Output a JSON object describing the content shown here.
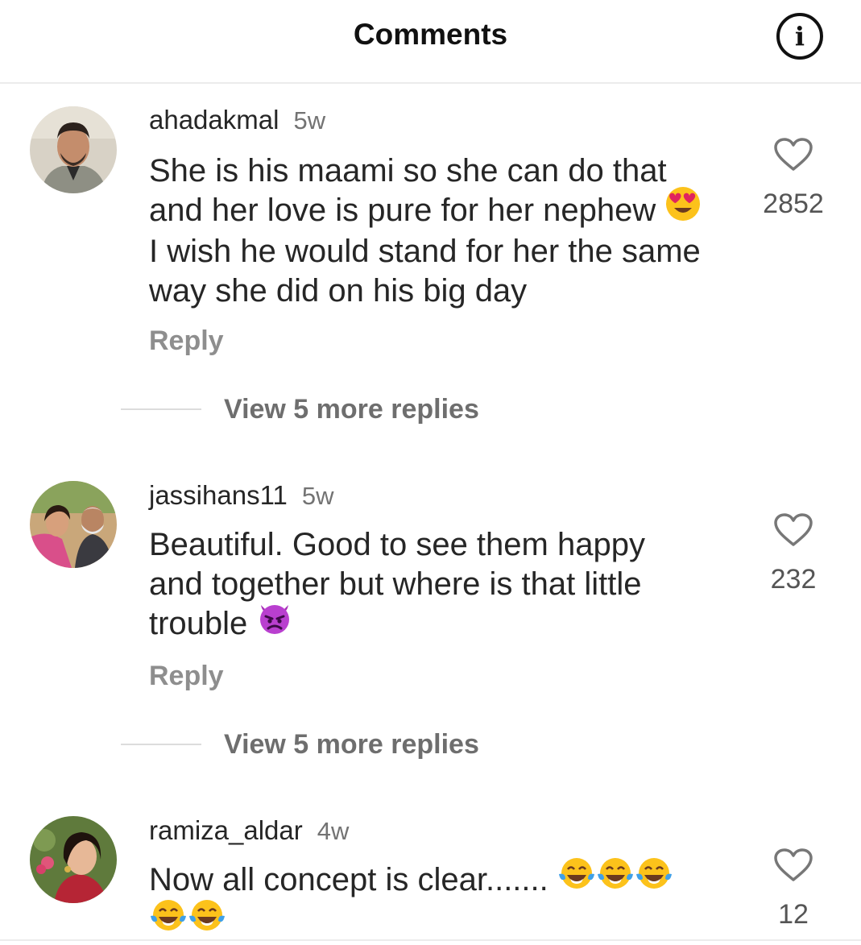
{
  "header": {
    "title": "Comments",
    "info_icon": "i"
  },
  "comments": [
    {
      "username": "ahadakmal",
      "time": "5w",
      "text_lines": [
        "She is his maami so she can do that",
        "and her love is pure for her nephew",
        "I wish he would stand for her the same",
        "way she did on his big day"
      ],
      "emoji": "heart-eyes",
      "likes": "2852",
      "reply_label": "Reply",
      "view_replies": "View 5 more replies"
    },
    {
      "username": "jassihans11",
      "time": "5w",
      "text_lines": [
        "Beautiful. Good to see them happy",
        "and together but where is that little",
        "trouble"
      ],
      "emoji": "angry-devil",
      "likes": "232",
      "reply_label": "Reply",
      "view_replies": "View 5 more replies"
    },
    {
      "username": "ramiza_aldar",
      "time": "4w",
      "text_lines": [
        "Now all concept is clear......."
      ],
      "emoji": "tears-of-joy",
      "likes": "12"
    }
  ],
  "colors": {
    "divider": "#ececec",
    "secondary_text": "#737373"
  }
}
